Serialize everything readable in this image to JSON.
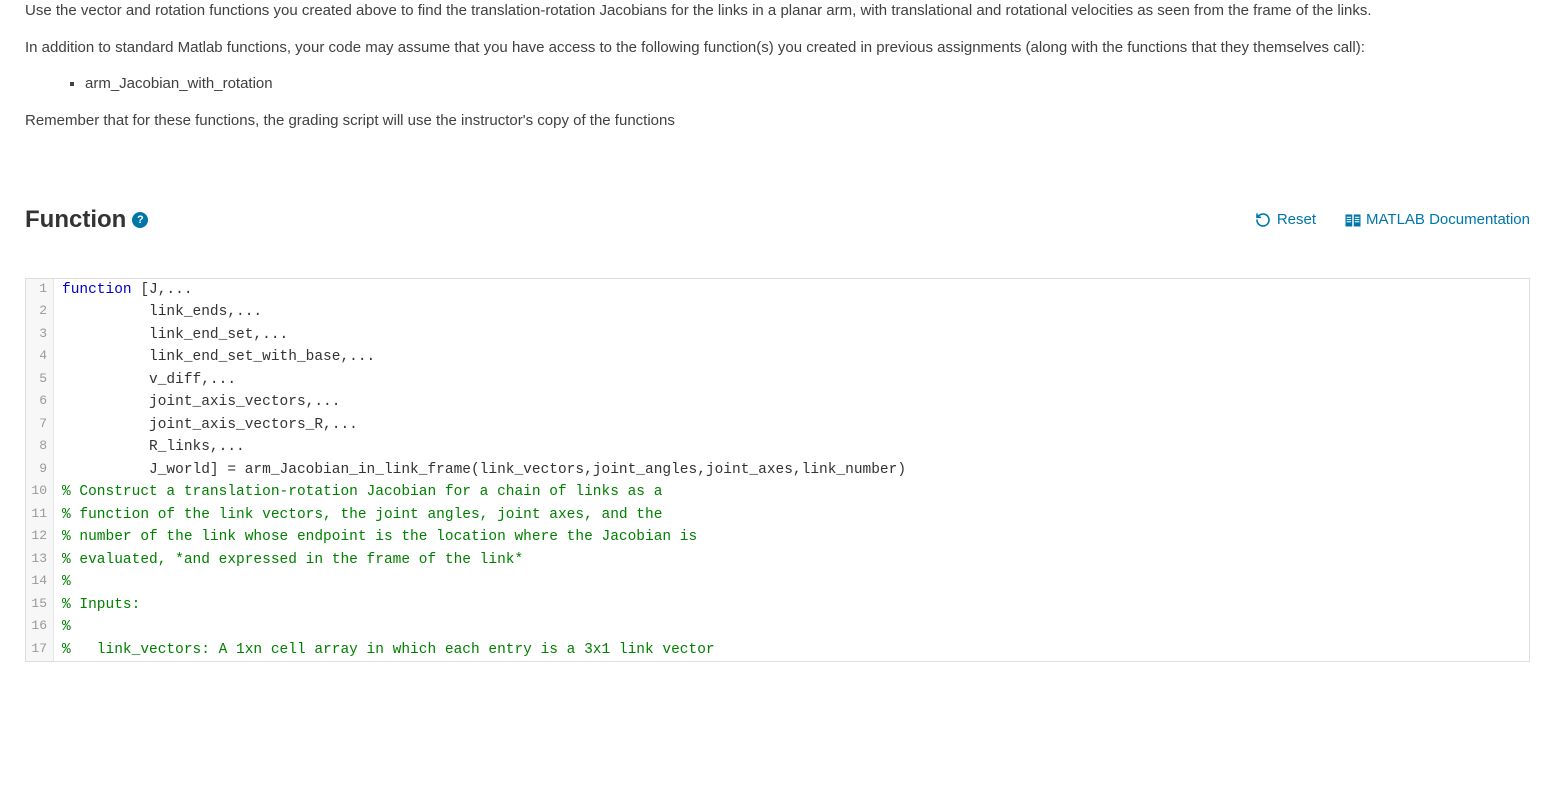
{
  "instructions": {
    "p1": "Use the vector and rotation functions you created above to find the translation-rotation Jacobians for the links in a planar arm, with translational and rotational velocities as seen from the frame of the links.",
    "p2": "In addition to standard Matlab functions, your code may assume that you have access to the following function(s) you created in previous assignments (along with the functions that they themselves call):",
    "bullet1": "arm_Jacobian_with_rotation",
    "p3": "Remember that for these functions, the grading script will use the instructor's copy of the functions"
  },
  "section": {
    "title": "Function",
    "help_glyph": "?",
    "reset_label": "Reset",
    "doc_label": "MATLAB Documentation"
  },
  "code": {
    "lines": [
      {
        "n": "1",
        "segs": [
          {
            "t": "function ",
            "c": "tok-keyword"
          },
          {
            "t": "[J,...",
            "c": ""
          }
        ]
      },
      {
        "n": "2",
        "segs": [
          {
            "t": "          link_ends,...",
            "c": ""
          }
        ]
      },
      {
        "n": "3",
        "segs": [
          {
            "t": "          link_end_set,...",
            "c": ""
          }
        ]
      },
      {
        "n": "4",
        "segs": [
          {
            "t": "          link_end_set_with_base,...",
            "c": ""
          }
        ]
      },
      {
        "n": "5",
        "segs": [
          {
            "t": "          v_diff,...",
            "c": ""
          }
        ]
      },
      {
        "n": "6",
        "segs": [
          {
            "t": "          joint_axis_vectors,...",
            "c": ""
          }
        ]
      },
      {
        "n": "7",
        "segs": [
          {
            "t": "          joint_axis_vectors_R,...",
            "c": ""
          }
        ]
      },
      {
        "n": "8",
        "segs": [
          {
            "t": "          R_links,...",
            "c": ""
          }
        ]
      },
      {
        "n": "9",
        "segs": [
          {
            "t": "          J_world] = arm_Jacobian_in_link_frame(link_vectors,joint_angles,joint_axes,link_number)",
            "c": ""
          }
        ]
      },
      {
        "n": "10",
        "segs": [
          {
            "t": "% Construct a translation-rotation Jacobian for a chain of links as a",
            "c": "tok-comment"
          }
        ]
      },
      {
        "n": "11",
        "segs": [
          {
            "t": "% function of the link vectors, the joint angles, joint axes, and the",
            "c": "tok-comment"
          }
        ]
      },
      {
        "n": "12",
        "segs": [
          {
            "t": "% number of the link whose endpoint is the location where the Jacobian is",
            "c": "tok-comment"
          }
        ]
      },
      {
        "n": "13",
        "segs": [
          {
            "t": "% evaluated, *and expressed in the frame of the link*",
            "c": "tok-comment"
          }
        ]
      },
      {
        "n": "14",
        "segs": [
          {
            "t": "%",
            "c": "tok-comment"
          }
        ]
      },
      {
        "n": "15",
        "segs": [
          {
            "t": "% Inputs:",
            "c": "tok-comment"
          }
        ]
      },
      {
        "n": "16",
        "segs": [
          {
            "t": "%",
            "c": "tok-comment"
          }
        ]
      },
      {
        "n": "17",
        "segs": [
          {
            "t": "%   link_vectors: A 1xn cell array in which each entry is a 3x1 link vector",
            "c": "tok-comment"
          }
        ]
      }
    ]
  }
}
